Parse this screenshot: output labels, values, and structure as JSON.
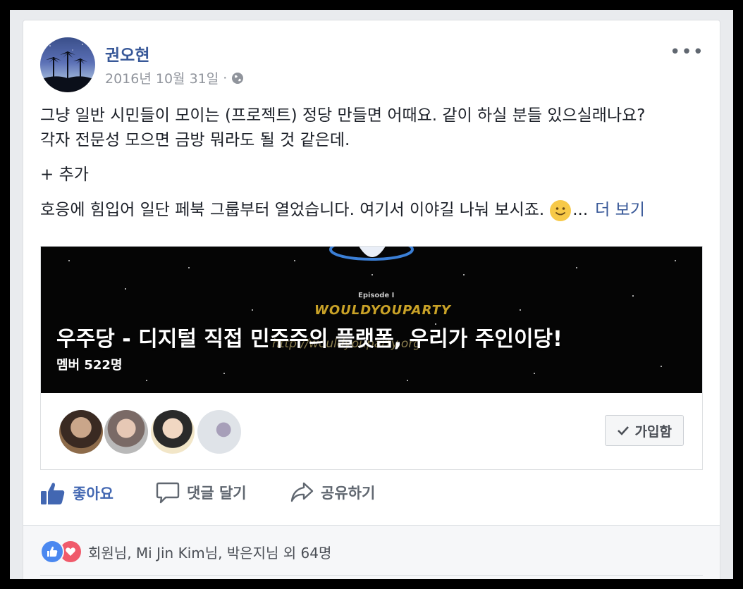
{
  "post": {
    "author": "권오현",
    "date": "2016년 10월 31일",
    "separator": "·",
    "privacy_icon": "globe-icon",
    "more_icon": "•••",
    "text_line1": "그냥 일반 시민들이 모이는 (프로젝트) 정당 만들면 어때요. 같이 하실 분들 있으실래나요?",
    "text_line2": "각자 전문성 모으면 금방 뭐라도 될 것 같은데.",
    "text_add": "+ 추가",
    "text_line3": "호응에 힘입어 일단 페북 그룹부터 열었습니다. 여기서 이야길 나눠 보시죠.",
    "ellipsis": "...",
    "see_more": "더 보기"
  },
  "attachment": {
    "group_name": "우주당 - 디지털 직접 민주주의 플랫폼, 우리가 주인이당!",
    "members": "멤버 522명",
    "banner_episode": "Episode I",
    "banner_brand": "WOULDYOUPARTY",
    "banner_url": "http://wouldyouparty.org",
    "join_label": "가입함"
  },
  "actions": {
    "like": "좋아요",
    "comment": "댓글 달기",
    "share": "공유하기"
  },
  "reactions": {
    "text": "회원님, Mi Jin Kim님, 박은지님 외 64명"
  },
  "colors": {
    "link": "#385898",
    "like_active": "#4267b2",
    "reaction_like": "#4b88f0",
    "reaction_love": "#f05a6b"
  }
}
